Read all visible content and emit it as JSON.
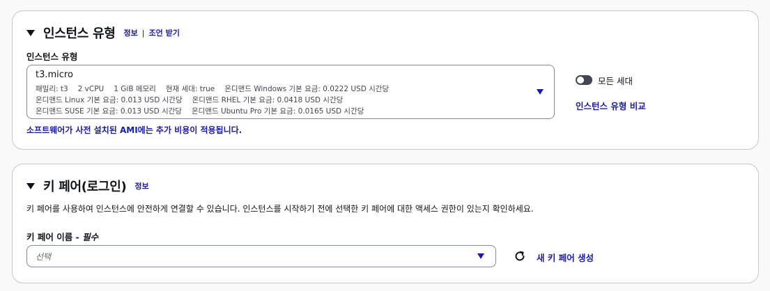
{
  "instance_section": {
    "title": "인스턴스 유형",
    "info_link": "정보",
    "separator": "|",
    "advice_link": "조언 받기",
    "field_label": "인스턴스 유형",
    "selected": {
      "name": "t3.micro",
      "line1": [
        "패밀리: t3",
        "2 vCPU",
        "1 GiB 메모리",
        "현재 세대: true",
        "온디맨드 Windows 기본 요금: 0.0222 USD 시간당"
      ],
      "line2": [
        "온디맨드 Linux 기본 요금: 0.013 USD 시간당",
        "온디맨드 RHEL 기본 요금: 0.0418 USD 시간당"
      ],
      "line3": [
        "온디맨드 SUSE 기본 요금: 0.013 USD 시간당",
        "온디맨드 Ubuntu Pro 기본 요금: 0.0165 USD 시간당"
      ]
    },
    "ami_note": "소프트웨어가 사전 설치된 AMI에는 추가 비용이 적용됩니다.",
    "all_generations_label": "모든 세대",
    "all_generations_on": false,
    "compare_link": "인스턴스 유형 비교"
  },
  "keypair_section": {
    "title": "키 페어(로그인)",
    "info_link": "정보",
    "description": "키 페어를 사용하여 인스턴스에 안전하게 연결할 수 있습니다. 인스턴스를 시작하기 전에 선택한 키 페어에 대한 액세스 권한이 있는지 확인하세요.",
    "field_label": "키 페어 이름",
    "field_required": " - 필수",
    "select_placeholder": "선택",
    "create_link": "새 키 페어 생성"
  },
  "colors": {
    "link": "#1a1aa8",
    "border": "#c6c6cd",
    "text": "#0f141a"
  }
}
